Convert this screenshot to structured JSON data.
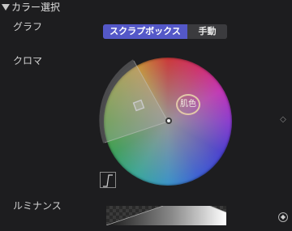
{
  "header": {
    "title": "カラー選択"
  },
  "graph": {
    "label": "グラフ",
    "options": [
      "スクラプボックス",
      "手動"
    ],
    "selected": "スクラプボックス",
    "accent_color": "#5458c8"
  },
  "chroma": {
    "label": "クロマ",
    "skin_tone_label": "肌色",
    "icons": {
      "side_button": "diamond-icon",
      "curve_button": "curve-icon"
    }
  },
  "luminance": {
    "label": "ルミナンス",
    "icons": {
      "corner_button": "keyframe-icon"
    }
  }
}
